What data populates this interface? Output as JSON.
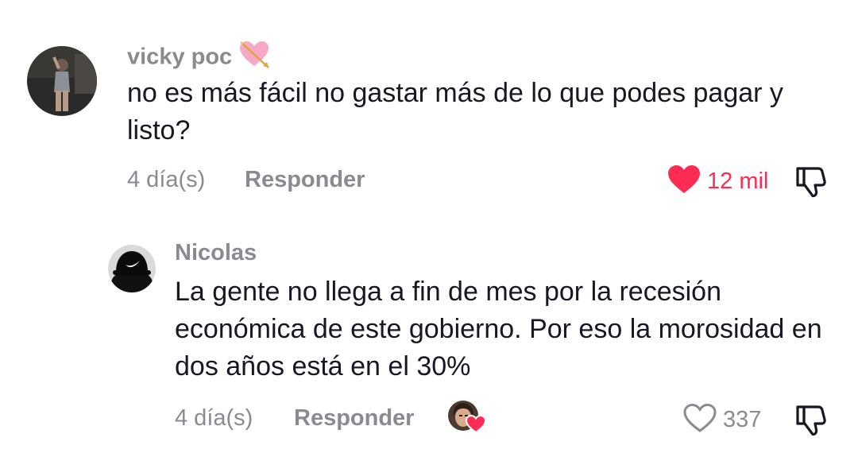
{
  "comments": [
    {
      "username": "vicky poc",
      "username_emoji": "heart-with-arrow-icon",
      "text": "no es más fácil no gastar más de lo que podes pagar y listo?",
      "time": "4 día(s)",
      "reply_label": "Responder",
      "likes": "12 mil",
      "liked": true
    },
    {
      "username": "Nicolas",
      "text": "La gente no llega a fin de mes por la recesión económica de este gobierno. Por eso la morosidad en dos años está en el 30%",
      "time": "4 día(s)",
      "reply_label": "Responder",
      "likes": "337",
      "liked": false
    }
  ],
  "colors": {
    "liked_heart": "#fe2c55",
    "muted": "#8a8b91",
    "text": "#161823"
  }
}
